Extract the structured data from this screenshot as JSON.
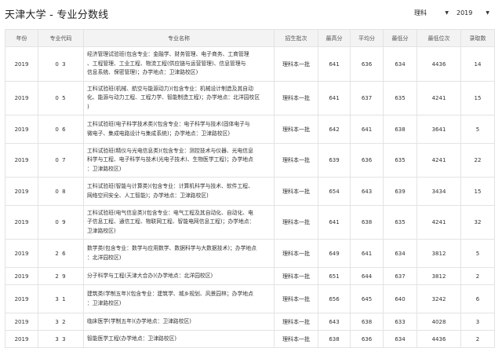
{
  "header": {
    "title": "天津大学 - 专业分数线",
    "type_select": "理科",
    "year_select": "2019"
  },
  "table": {
    "columns": [
      "年份",
      "专业代码",
      "专业名称",
      "招生批次",
      "最高分",
      "平均分",
      "最低分",
      "最低位次",
      "录取数"
    ],
    "rows": [
      {
        "year": "2019",
        "code": "0 3",
        "name": "经济管理试验班(包含专业：金融学、财务管理、电子商务、工商管理\n、工程管理、工业工程、物流工程(供应链与运营管理)、信息管理与\n信息系统、保密管理)；办学地点：卫津路校区)",
        "batch": "理科本一批",
        "max": "641",
        "avg": "636",
        "min": "634",
        "rank": "4436",
        "count": "14"
      },
      {
        "year": "2019",
        "code": "0 5",
        "name": "工科试验班(机械、航空与能源动力)(包含专业：机械设计制造及其自动\n化、能源与动力工程、工程力学、智能制造工程)；办学地点：北洋园校区\n)",
        "batch": "理科本一批",
        "max": "641",
        "avg": "637",
        "min": "635",
        "rank": "4241",
        "count": "15"
      },
      {
        "year": "2019",
        "code": "0 6",
        "name": "工科试验班(电子科学技术类)(包含专业：电子科学与技术(固体电子与\n微电子、集成电路设计与集成系统)；办学地点：卫津路校区)",
        "batch": "理科本一批",
        "max": "642",
        "avg": "641",
        "min": "638",
        "rank": "3641",
        "count": "5"
      },
      {
        "year": "2019",
        "code": "0 7",
        "name": "工科试验班(精仪与光电信息类)(包含专业：测控技术与仪器、光电信息\n科学与工程、电子科学与技术(光电子技术)、生物医学工程)；办学地点\n：卫津路校区)",
        "batch": "理科本一批",
        "max": "639",
        "avg": "636",
        "min": "635",
        "rank": "4241",
        "count": "22"
      },
      {
        "year": "2019",
        "code": "0 8",
        "name": "工科试验班(智能与计算类)(包含专业：计算机科学与技术、软件工程、\n网络空间安全、人工智能)；办学地点：卫津路校区)",
        "batch": "理科本一批",
        "max": "654",
        "avg": "643",
        "min": "639",
        "rank": "3434",
        "count": "15"
      },
      {
        "year": "2019",
        "code": "0 9",
        "name": "工科试验班(电气信息类)(包含专业：电气工程及其自动化、自动化、电\n子信息工程、通信工程、物联网工程、智能电网信息工程)；办学地点：\n卫津路校区)",
        "batch": "理科本一批",
        "max": "641",
        "avg": "638",
        "min": "635",
        "rank": "4241",
        "count": "32"
      },
      {
        "year": "2019",
        "code": "2 6",
        "name": "数学类(包含专业：数学与应用数学、数据科学与大数据技术)；办学地点\n：北洋园校区)",
        "batch": "理科本一批",
        "max": "649",
        "avg": "641",
        "min": "634",
        "rank": "3812",
        "count": "5"
      },
      {
        "year": "2019",
        "code": "2 9",
        "name": "分子科学与工程(天津大合办)(办学地点：北洋园校区)",
        "batch": "理科本一批",
        "max": "651",
        "avg": "644",
        "min": "637",
        "rank": "3812",
        "count": "2"
      },
      {
        "year": "2019",
        "code": "3 1",
        "name": "建筑类(学制五年)(包含专业：建筑学、城乡规划、风景园林；办学地点\n：卫津路校区)",
        "batch": "理科本一批",
        "max": "656",
        "avg": "645",
        "min": "640",
        "rank": "3242",
        "count": "6"
      },
      {
        "year": "2019",
        "code": "3 2",
        "name": "临床医学(学制五年)(办学地点：卫津路校区)",
        "batch": "理科本一批",
        "max": "643",
        "avg": "638",
        "min": "633",
        "rank": "4028",
        "count": "3"
      },
      {
        "year": "2019",
        "code": "3 3",
        "name": "智能医学工程(办学地点：卫津路校区)",
        "batch": "理科本一批",
        "max": "638",
        "avg": "636",
        "min": "634",
        "rank": "4436",
        "count": "2"
      }
    ]
  }
}
